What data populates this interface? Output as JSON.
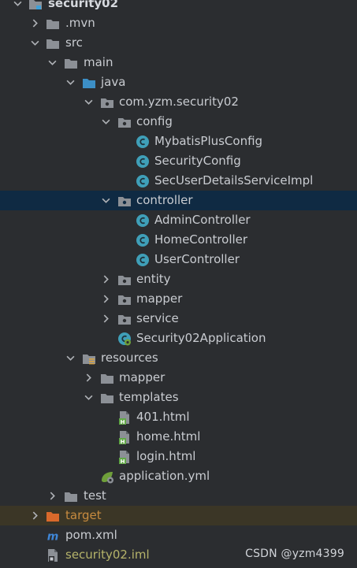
{
  "project": {
    "name": "security02"
  },
  "tree": {
    "mvn": ".mvn",
    "src": "src",
    "main": "main",
    "java": "java",
    "package": "com.yzm.security02",
    "config": "config",
    "config_classes": [
      "MybatisPlusConfig",
      "SecurityConfig",
      "SecUserDetailsServiceImpl"
    ],
    "controller": "controller",
    "controller_classes": [
      "AdminController",
      "HomeController",
      "UserController"
    ],
    "entity": "entity",
    "mapper": "mapper",
    "service": "service",
    "app_class": "Security02Application",
    "resources": "resources",
    "res_mapper": "mapper",
    "templates": "templates",
    "html_files": [
      "401.html",
      "home.html",
      "login.html"
    ],
    "application_yml": "application.yml",
    "test": "test",
    "target": "target",
    "pom": "pom.xml",
    "iml": "security02.iml"
  },
  "watermark": "CSDN @yzm4399",
  "colors": {
    "background": "#2b2d30",
    "selected_row": "#0f2a43",
    "excluded_row": "#3b3626",
    "class_icon": "#3f9fb8"
  }
}
